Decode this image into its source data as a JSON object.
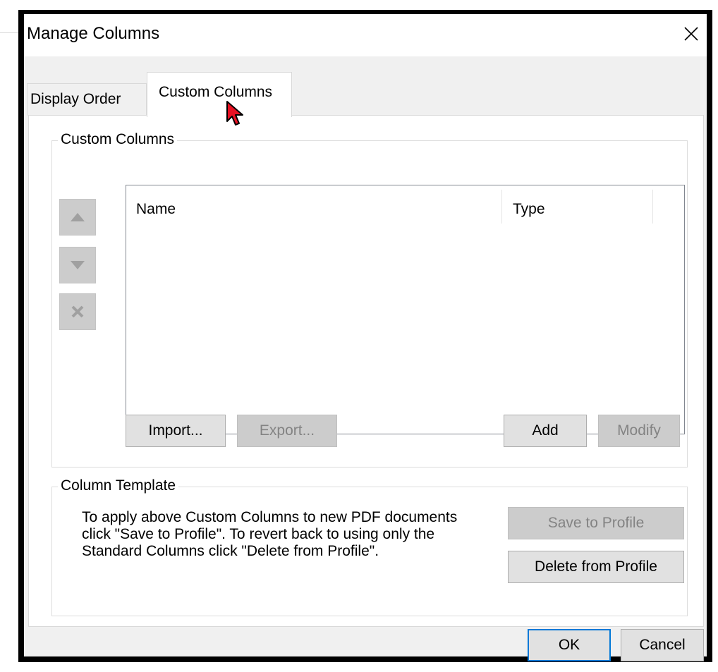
{
  "window": {
    "title": "Manage Columns",
    "close_icon": "close-icon"
  },
  "tabs": [
    {
      "label": "Display Order",
      "active": false
    },
    {
      "label": "Custom Columns",
      "active": true
    }
  ],
  "custom_columns": {
    "group_label": "Custom Columns",
    "list": {
      "columns": [
        "Name",
        "Type"
      ],
      "rows": []
    },
    "side_buttons": [
      {
        "name": "move-up-button",
        "icon": "triangle-up-icon",
        "enabled": false
      },
      {
        "name": "move-down-button",
        "icon": "triangle-down-icon",
        "enabled": false
      },
      {
        "name": "delete-button",
        "icon": "x-icon",
        "enabled": false
      }
    ],
    "buttons": {
      "import": "Import...",
      "export": "Export...",
      "add": "Add",
      "modify": "Modify"
    }
  },
  "column_template": {
    "group_label": "Column Template",
    "description": "To apply above Custom Columns to new PDF documents click \"Save to Profile\". To revert back to using only the Standard Columns click \"Delete from Profile\".",
    "buttons": {
      "save": "Save to Profile",
      "delete": "Delete from Profile"
    }
  },
  "footer": {
    "ok": "OK",
    "cancel": "Cancel"
  },
  "colors": {
    "accent": "#0078d7",
    "cursor": "#e81123"
  }
}
